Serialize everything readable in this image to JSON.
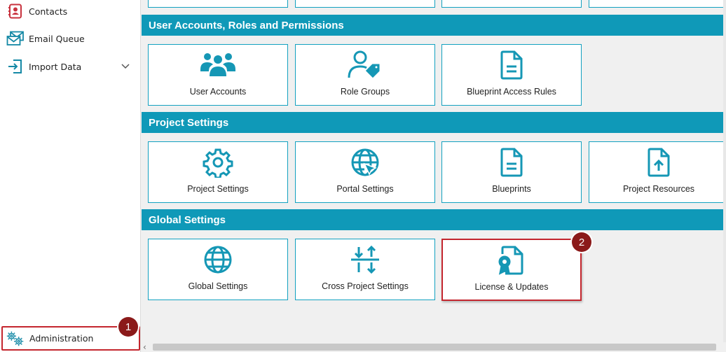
{
  "sidebar": {
    "items": [
      {
        "label": "Contacts",
        "icon": "contacts-icon"
      },
      {
        "label": "Email Queue",
        "icon": "email-queue-icon"
      },
      {
        "label": "Import Data",
        "icon": "import-icon"
      }
    ],
    "admin_label": "Administration",
    "badge_1": "1"
  },
  "sections": [
    {
      "title": "User Accounts, Roles and Permissions",
      "tiles": [
        "User Accounts",
        "Role Groups",
        "Blueprint Access Rules"
      ]
    },
    {
      "title": "Project Settings",
      "tiles": [
        "Project Settings",
        "Portal Settings",
        "Blueprints",
        "Project Resources"
      ]
    },
    {
      "title": "Global Settings",
      "tiles": [
        "Global Settings",
        "Cross Project Settings",
        "License & Updates"
      ]
    }
  ],
  "badge_2": "2",
  "colors": {
    "accent": "#0f99b8",
    "highlight": "#c4262e",
    "badge": "#8b1a1a"
  }
}
